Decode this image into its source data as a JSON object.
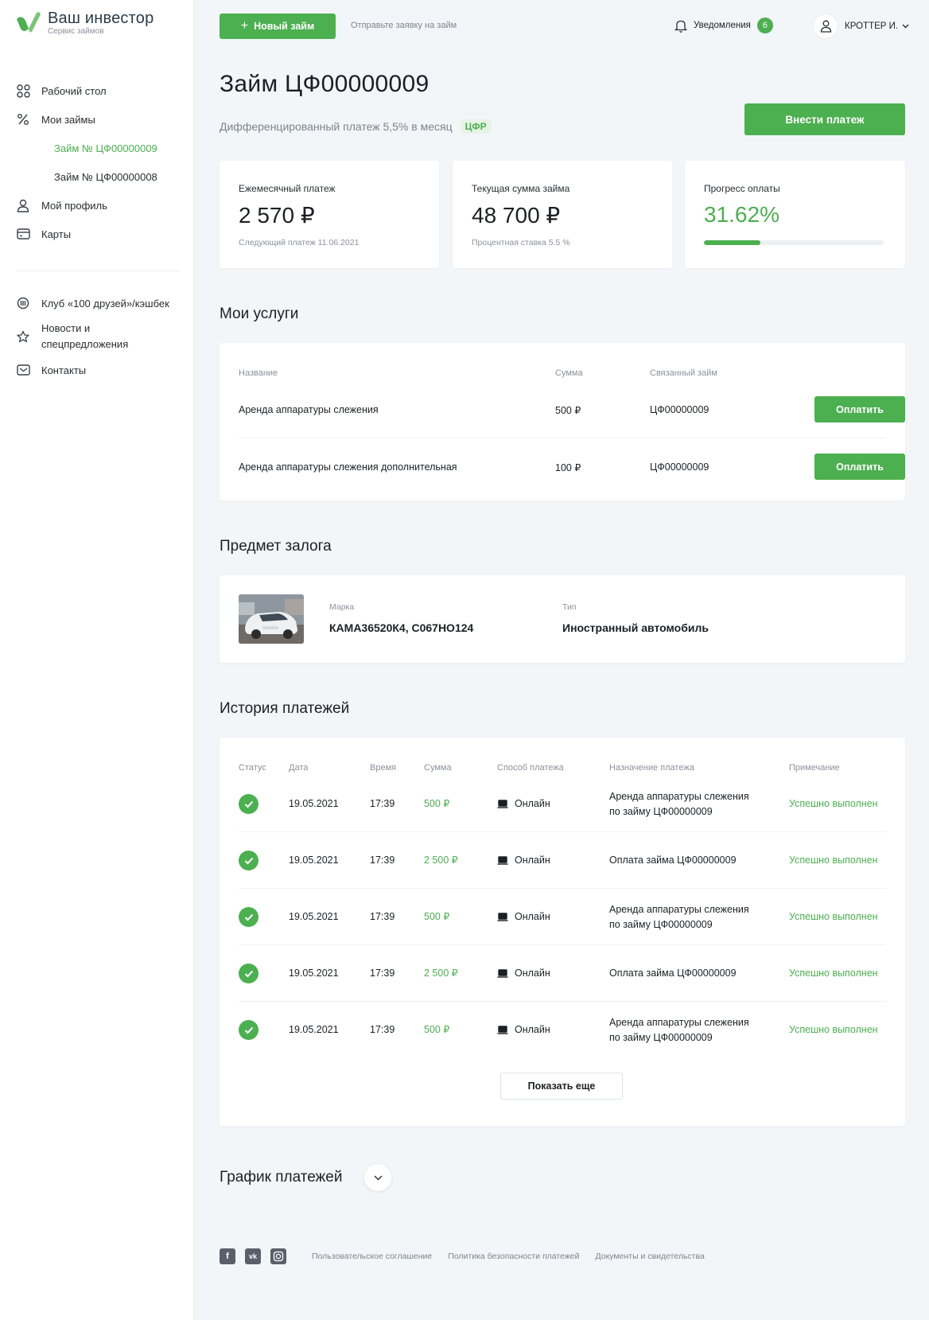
{
  "brand": {
    "title": "Ваш инвестор",
    "subtitle": "Сервис займов",
    "accent": "#4caf50"
  },
  "sidebar": {
    "items": [
      {
        "label": "Рабочий стол",
        "icon": "grid-icon"
      },
      {
        "label": "Мои займы",
        "icon": "percent-icon"
      },
      {
        "label": "Займ № ЦФ00000009",
        "sub": true,
        "active": true
      },
      {
        "label": "Займ № ЦФ00000008",
        "sub": true
      },
      {
        "label": "Мой профиль",
        "icon": "user-icon"
      },
      {
        "label": "Карты",
        "icon": "card-icon"
      }
    ],
    "secondary": [
      {
        "label": "Клуб «100 друзей»/кэшбек",
        "icon": "club-icon"
      },
      {
        "label_line1": "Новости и",
        "label_line2": "спецпредложения",
        "icon": "star-icon"
      },
      {
        "label": "Контакты",
        "icon": "mail-icon"
      }
    ]
  },
  "topbar": {
    "new_loan": "Новый займ",
    "hint": "Отправьте заявку на займ",
    "notifications": "Уведомления",
    "notif_count": "6",
    "user": "КРОТТЕР И."
  },
  "loan": {
    "title": "Займ ЦФ00000009",
    "subtitle": "Дифференцированный платеж 5,5% в месяц",
    "tag": "ЦФР",
    "pay_button": "Внести платеж"
  },
  "stats": [
    {
      "label": "Ежемесячный платеж",
      "value": "2 570 ₽",
      "note": "Следующий платеж 11.06.2021"
    },
    {
      "label": "Текущая сумма займа",
      "value": "48 700 ₽",
      "note": "Процентная ставка 5.5 %"
    },
    {
      "label": "Прогресс оплаты",
      "value": "31.62%",
      "progress": 0.3162
    }
  ],
  "services": {
    "title": "Мои услуги",
    "headers": {
      "name": "Название",
      "sum": "Сумма",
      "loan": "Связанный займ"
    },
    "pay_label": "Оплатить",
    "rows": [
      {
        "name": "Аренда аппаратуры слежения",
        "sum": "500 ₽",
        "loan": "ЦФ00000009"
      },
      {
        "name": "Аренда аппаратуры слежения дополнительная",
        "sum": "100 ₽",
        "loan": "ЦФ00000009"
      }
    ]
  },
  "collateral": {
    "title": "Предмет залога",
    "brand_label": "Марка",
    "brand_value": "КАМА36520К4, С067НО124",
    "type_label": "Тип",
    "type_value": "Иностранный автомобиль"
  },
  "history": {
    "title": "История платежей",
    "headers": {
      "status": "Статус",
      "date": "Дата",
      "time": "Время",
      "sum": "Сумма",
      "method": "Способ платежа",
      "purpose": "Назначение платежа",
      "note": "Примечание"
    },
    "rows": [
      {
        "date": "19.05.2021",
        "time": "17:39",
        "sum": "500 ₽",
        "method": "Онлайн",
        "purpose_1": "Аренда аппаратуры слежения",
        "purpose_2": "по займу ЦФ00000009",
        "note": "Успешно выполнен"
      },
      {
        "date": "19.05.2021",
        "time": "17:39",
        "sum": "2 500 ₽",
        "method": "Онлайн",
        "purpose_1": "Оплата займа ЦФ00000009",
        "purpose_2": "",
        "note": "Успешно выполнен"
      },
      {
        "date": "19.05.2021",
        "time": "17:39",
        "sum": "500 ₽",
        "method": "Онлайн",
        "purpose_1": "Аренда аппаратуры слежения",
        "purpose_2": "по займу ЦФ00000009",
        "note": "Успешно выполнен"
      },
      {
        "date": "19.05.2021",
        "time": "17:39",
        "sum": "2 500 ₽",
        "method": "Онлайн",
        "purpose_1": "Оплата займа ЦФ00000009",
        "purpose_2": "",
        "note": "Успешно выполнен"
      },
      {
        "date": "19.05.2021",
        "time": "17:39",
        "sum": "500 ₽",
        "method": "Онлайн",
        "purpose_1": "Аренда аппаратуры слежения",
        "purpose_2": "по займу ЦФ00000009",
        "note": "Успешно выполнен"
      }
    ],
    "show_more": "Показать еще"
  },
  "schedule": {
    "title": "График платежей"
  },
  "footer": {
    "social": [
      "facebook-icon",
      "vk-icon",
      "instagram-icon"
    ],
    "links": [
      "Пользовательское соглашение",
      "Политика безопасности платежей",
      "Документы и свидетельства"
    ]
  }
}
